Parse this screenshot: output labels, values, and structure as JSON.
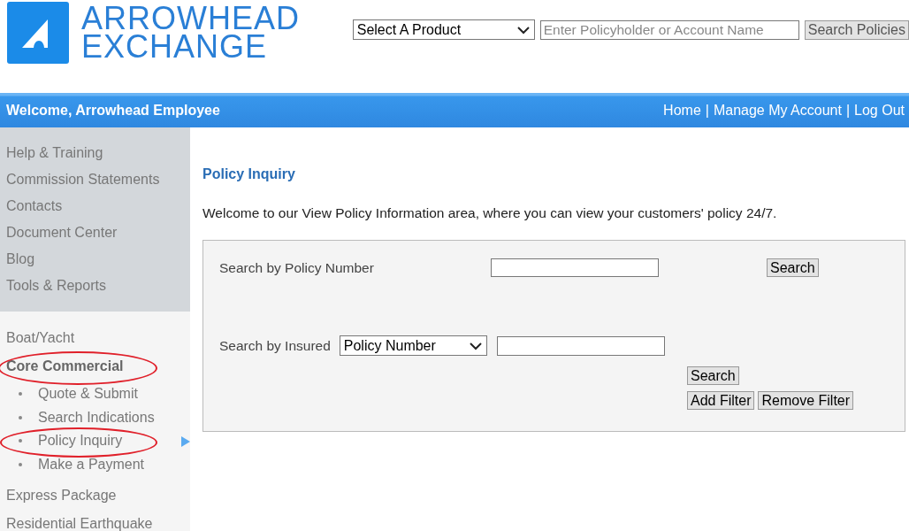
{
  "header": {
    "logo": {
      "line_1": "ARROWHEAD",
      "line_2": "EXCHANGE"
    },
    "product_select": {
      "value": "Select A Product"
    },
    "name_field": {
      "placeholder": "Enter Policyholder or Account Name"
    },
    "search_button": "Search Policies"
  },
  "top_bar": {
    "welcome": "Welcome, Arrowhead Employee",
    "links": [
      "Home",
      "Manage My Account",
      "Log Out"
    ],
    "separator": "|"
  },
  "sidebar": {
    "links": [
      {
        "label": "Help & Training"
      },
      {
        "label": "Commission Statements"
      },
      {
        "label": "Contacts"
      },
      {
        "label": "Document Center"
      },
      {
        "label": "Blog"
      },
      {
        "label": "Tools & Reports"
      }
    ],
    "products": [
      {
        "label": "Boat/Yacht",
        "circled": false
      },
      {
        "label": "Core Commercial",
        "circled": true,
        "children": [
          {
            "label": "Quote & Submit",
            "circled": false,
            "selected": false
          },
          {
            "label": "Search Indications",
            "circled": false,
            "selected": false
          },
          {
            "label": "Policy Inquiry",
            "circled": true,
            "selected": true
          },
          {
            "label": "Make a Payment",
            "circled": false,
            "selected": false
          }
        ]
      },
      {
        "label": "Express Package",
        "circled": false
      },
      {
        "label": "Residential Earthquake",
        "circled": false
      }
    ]
  },
  "main": {
    "title": "Policy Inquiry",
    "intro": "Welcome to our View Policy Information area, where you can view your customers' policy 24/7.",
    "by_number": {
      "label": "Search by Policy Number",
      "button": "Search"
    },
    "by_insured": {
      "label": "Search by Insured",
      "select_value": "Policy Number",
      "search_button": "Search",
      "add_button": "Add Filter",
      "remove_button": "Remove Filter"
    }
  }
}
